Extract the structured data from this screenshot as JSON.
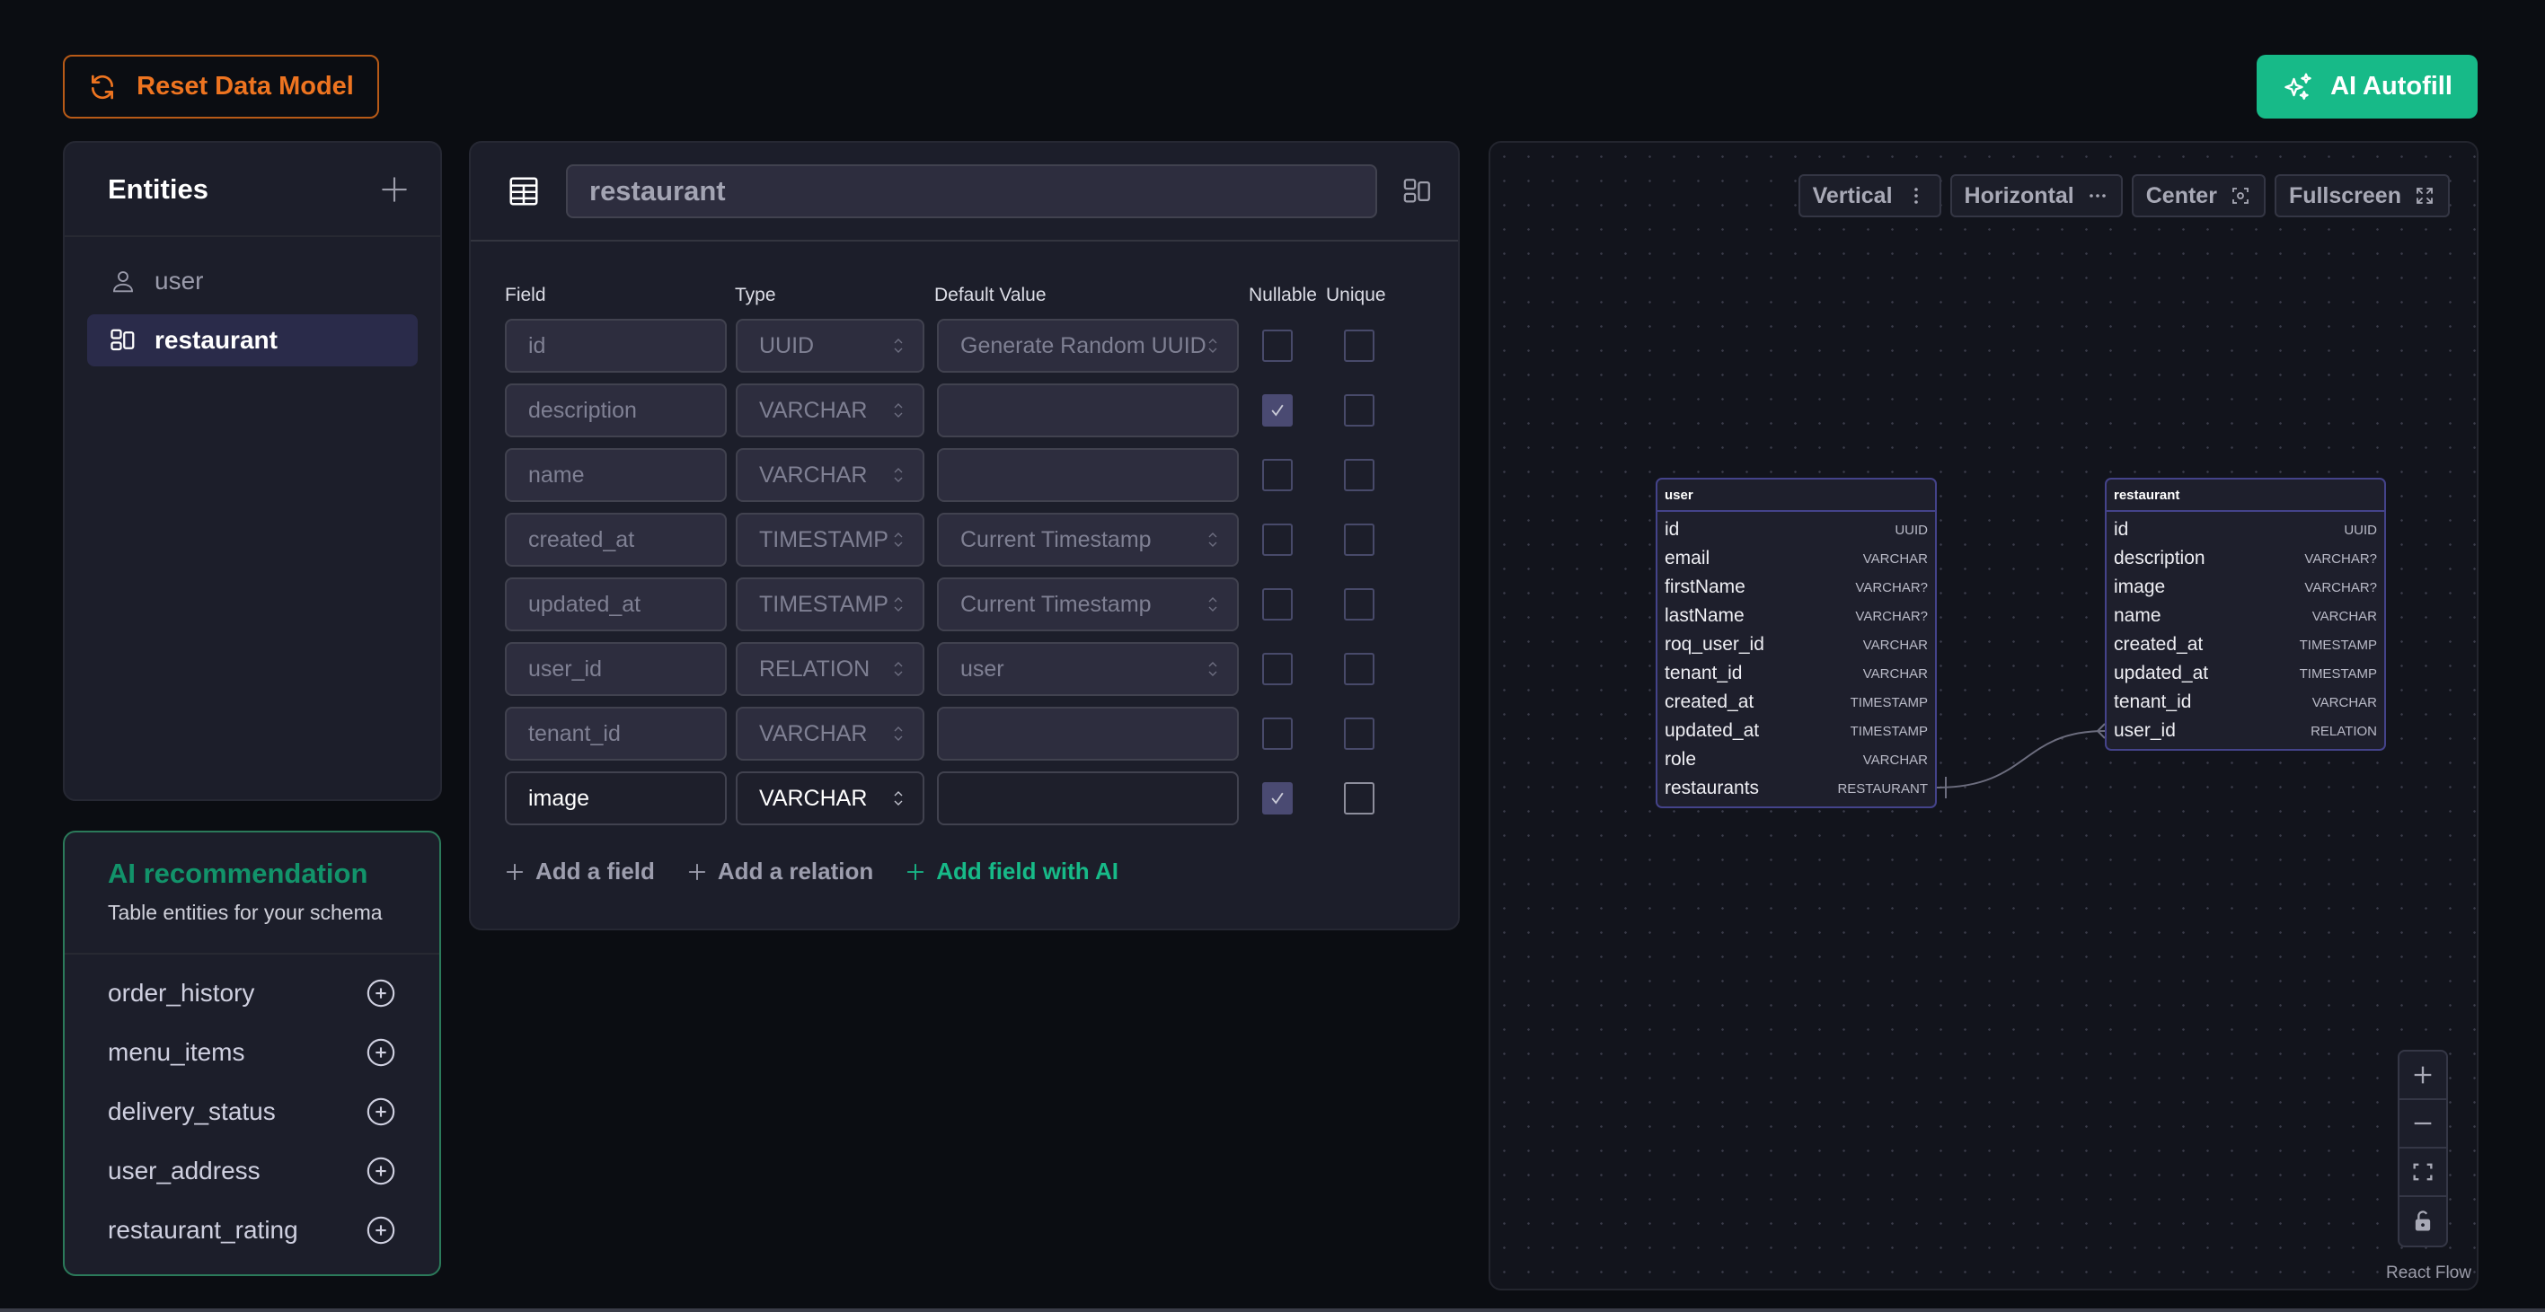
{
  "header": {
    "reset_label": "Reset Data Model",
    "ai_autofill_label": "AI Autofill"
  },
  "colors": {
    "accent_orange": "#ee7420",
    "accent_green": "#17ba88",
    "selected_bg": "#2a2b4a",
    "node_border": "#44438a"
  },
  "entities": {
    "title": "Entities",
    "items": [
      {
        "label": "user",
        "icon": "user-icon",
        "active": false
      },
      {
        "label": "restaurant",
        "icon": "layout-icon",
        "active": true
      }
    ]
  },
  "ai_recommendation": {
    "title": "AI recommendation",
    "subtitle": "Table entities for your schema",
    "items": [
      {
        "label": "order_history"
      },
      {
        "label": "menu_items"
      },
      {
        "label": "delivery_status"
      },
      {
        "label": "user_address"
      },
      {
        "label": "restaurant_rating"
      }
    ]
  },
  "editor": {
    "entity_name": "restaurant",
    "columns": {
      "field": "Field",
      "type": "Type",
      "default": "Default Value",
      "nullable": "Nullable",
      "unique": "Unique"
    },
    "rows": [
      {
        "field": "id",
        "type": "UUID",
        "default": "Generate Random UUID",
        "default_select": true,
        "nullable": false,
        "unique": false
      },
      {
        "field": "description",
        "type": "VARCHAR",
        "default": "",
        "default_select": false,
        "nullable": true,
        "unique": false
      },
      {
        "field": "name",
        "type": "VARCHAR",
        "default": "",
        "default_select": false,
        "nullable": false,
        "unique": false
      },
      {
        "field": "created_at",
        "type": "TIMESTAMP",
        "default": "Current Timestamp",
        "default_select": true,
        "nullable": false,
        "unique": false
      },
      {
        "field": "updated_at",
        "type": "TIMESTAMP",
        "default": "Current Timestamp",
        "default_select": true,
        "nullable": false,
        "unique": false
      },
      {
        "field": "user_id",
        "type": "RELATION",
        "default": "user",
        "default_select": true,
        "nullable": false,
        "unique": false
      },
      {
        "field": "tenant_id",
        "type": "VARCHAR",
        "default": "",
        "default_select": false,
        "nullable": false,
        "unique": false
      },
      {
        "field": "image",
        "type": "VARCHAR",
        "default": "",
        "default_select": false,
        "nullable": true,
        "unique": false,
        "editable": true
      }
    ],
    "actions": {
      "add_field": "Add a field",
      "add_relation": "Add a relation",
      "add_field_ai": "Add field with AI"
    }
  },
  "flow": {
    "toolbar": {
      "vertical": "Vertical",
      "horizontal": "Horizontal",
      "center": "Center",
      "fullscreen": "Fullscreen"
    },
    "nodes": {
      "user": {
        "title": "user",
        "fields": [
          {
            "name": "id",
            "type": "UUID"
          },
          {
            "name": "email",
            "type": "VARCHAR"
          },
          {
            "name": "firstName",
            "type": "VARCHAR?"
          },
          {
            "name": "lastName",
            "type": "VARCHAR?"
          },
          {
            "name": "roq_user_id",
            "type": "VARCHAR"
          },
          {
            "name": "tenant_id",
            "type": "VARCHAR"
          },
          {
            "name": "created_at",
            "type": "TIMESTAMP"
          },
          {
            "name": "updated_at",
            "type": "TIMESTAMP"
          },
          {
            "name": "role",
            "type": "VARCHAR"
          },
          {
            "name": "restaurants",
            "type": "RESTAURANT"
          }
        ]
      },
      "restaurant": {
        "title": "restaurant",
        "fields": [
          {
            "name": "id",
            "type": "UUID"
          },
          {
            "name": "description",
            "type": "VARCHAR?"
          },
          {
            "name": "image",
            "type": "VARCHAR?"
          },
          {
            "name": "name",
            "type": "VARCHAR"
          },
          {
            "name": "created_at",
            "type": "TIMESTAMP"
          },
          {
            "name": "updated_at",
            "type": "TIMESTAMP"
          },
          {
            "name": "tenant_id",
            "type": "VARCHAR"
          },
          {
            "name": "user_id",
            "type": "RELATION"
          }
        ]
      }
    },
    "edge": {
      "from": "user.restaurants",
      "to": "restaurant.user_id"
    },
    "attribution": "React Flow"
  }
}
